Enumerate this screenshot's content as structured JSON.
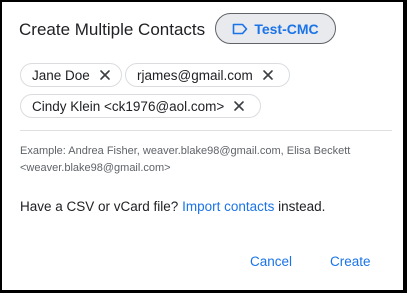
{
  "dialog": {
    "title": "Create Multiple Contacts",
    "label_chip": {
      "text": "Test-CMC",
      "icon": "label-icon"
    },
    "chips": [
      {
        "text": "Jane Doe",
        "remove_icon": "close-icon"
      },
      {
        "text": "rjames@gmail.com",
        "remove_icon": "close-icon"
      },
      {
        "text": "Cindy Klein <ck1976@aol.com>",
        "remove_icon": "close-icon"
      }
    ],
    "example_text": "Example: Andrea Fisher, weaver.blake98@gmail.com, Elisa Beckett <weaver.blake98@gmail.com>",
    "csv": {
      "prefix": "Have a CSV or vCard file? ",
      "link": "Import contacts",
      "suffix": " instead."
    },
    "actions": {
      "cancel": "Cancel",
      "create": "Create"
    }
  },
  "colors": {
    "accent": "#1a73e8",
    "text": "#202124",
    "muted": "#5f6368",
    "pill_bg": "#e8eaed"
  }
}
